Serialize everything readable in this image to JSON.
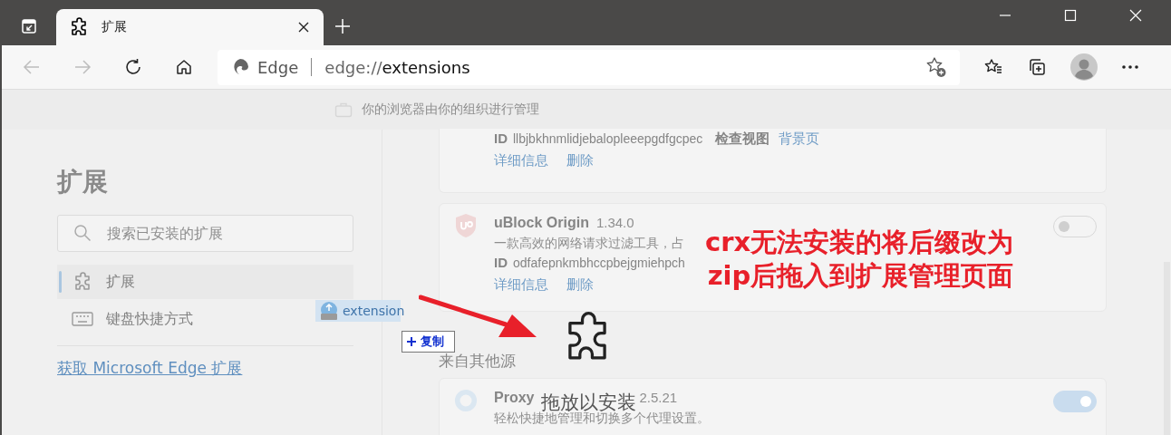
{
  "tabs": [
    {
      "title": "扩展",
      "selected": true
    }
  ],
  "address_bar": {
    "site_label": "Edge",
    "url_scheme": "edge://",
    "url_path": "extensions"
  },
  "banner": {
    "text": "你的浏览器由你的组织进行管理"
  },
  "sidebar": {
    "title": "扩展",
    "search": {
      "placeholder": "搜索已安装的扩展"
    },
    "items": [
      {
        "kind": "puzzle",
        "label": "扩展",
        "selected": true
      },
      {
        "kind": "keyboard",
        "label": "键盘快捷方式",
        "selected": false
      }
    ],
    "link": "获取 Microsoft Edge 扩展"
  },
  "extension_cards": [
    {
      "id_label": "ID",
      "id": "llbjbkhnmlidjebalopleeepgdfgcpec",
      "inspect_label": "检查视图",
      "inspect_link": "背景页",
      "links": [
        "详细信息",
        "删除"
      ]
    },
    {
      "name": "uBlock Origin",
      "version": "1.34.0",
      "description": "一款高效的网络请求过滤工具，占",
      "id_label": "ID",
      "id": "odfafepnkmbhccpbejgmiehpch",
      "links": [
        "详细信息",
        "删除"
      ],
      "on": false
    }
  ],
  "other_sources": {
    "heading": "来自其他源",
    "cards": [
      {
        "name": "Proxy",
        "version": "2.5.21",
        "description": "轻松快捷地管理和切换多个代理设置。",
        "on": true
      }
    ]
  },
  "drag": {
    "file_label": "extension",
    "effect": "复制"
  },
  "drop_overlay": {
    "label": "拖放以安装"
  },
  "annotation": {
    "lines": [
      "crx无法安装的将后缀改为",
      "zip后拖入到扩展管理页面"
    ]
  }
}
